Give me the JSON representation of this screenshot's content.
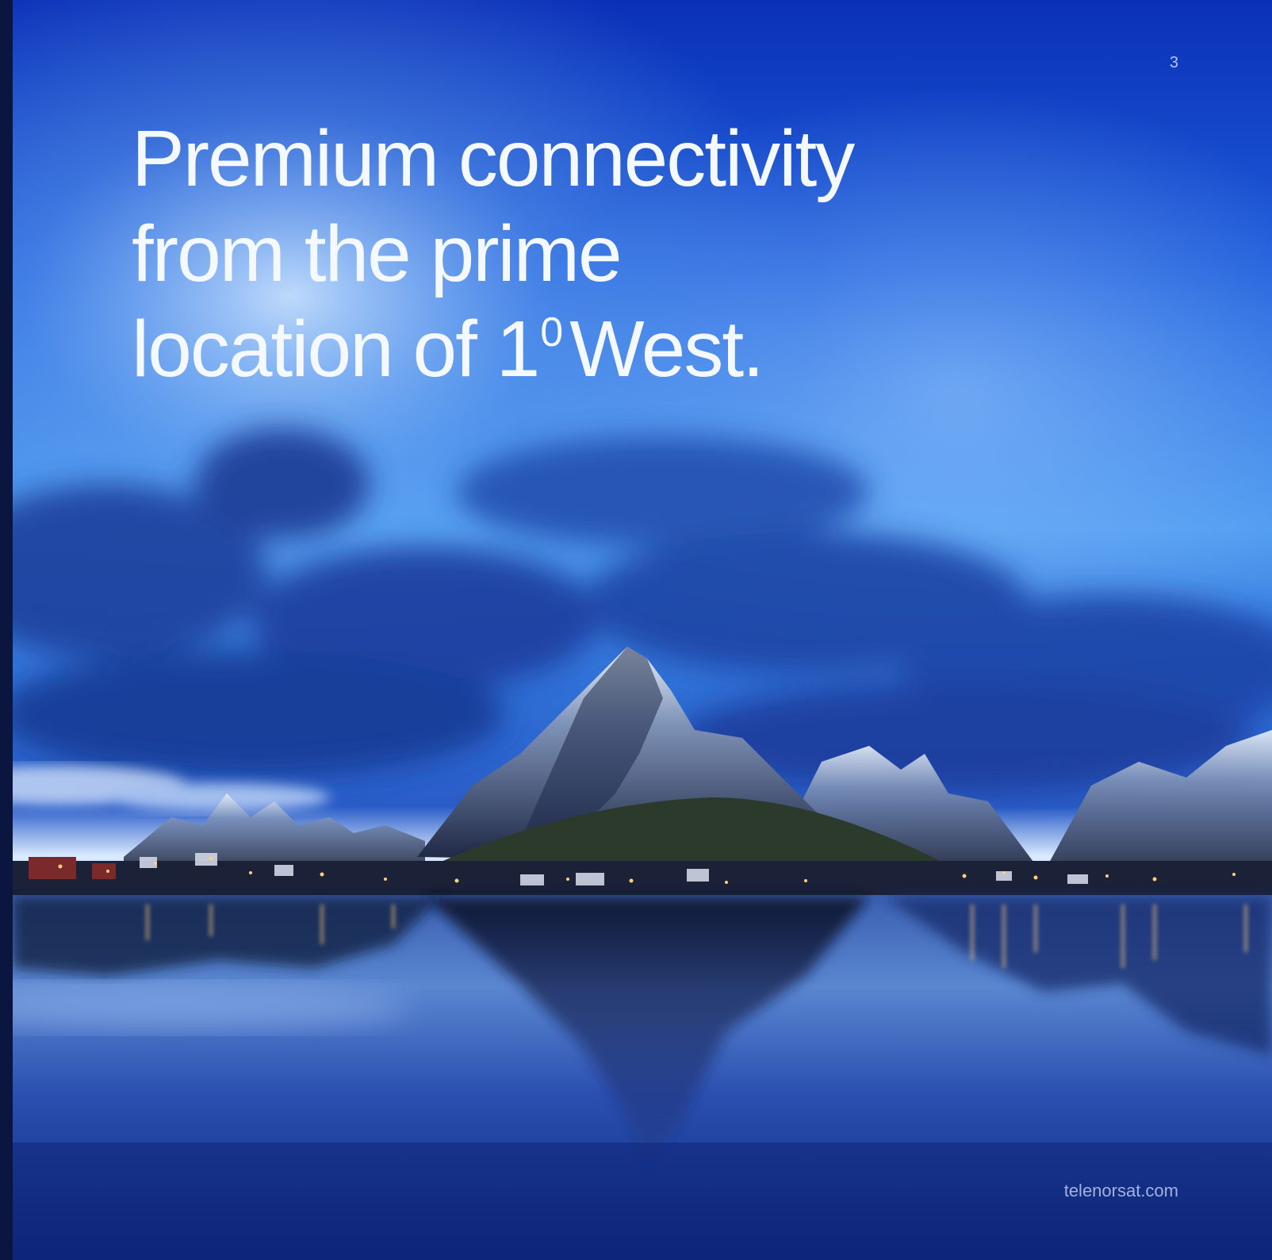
{
  "page": {
    "number": "3",
    "website": "telenorsat.com"
  },
  "headline": {
    "line1": "Premium connectivity",
    "line2": "from the prime",
    "line3_before": "location of 1",
    "line3_sup": "0",
    "line3_after": "West."
  },
  "colors": {
    "sky_top": "#0a35c2",
    "sky_mid": "#2f7ae8",
    "sky_horizon": "#cfe6ff",
    "water": "#1a3a96",
    "text": "#f4f8ff"
  }
}
